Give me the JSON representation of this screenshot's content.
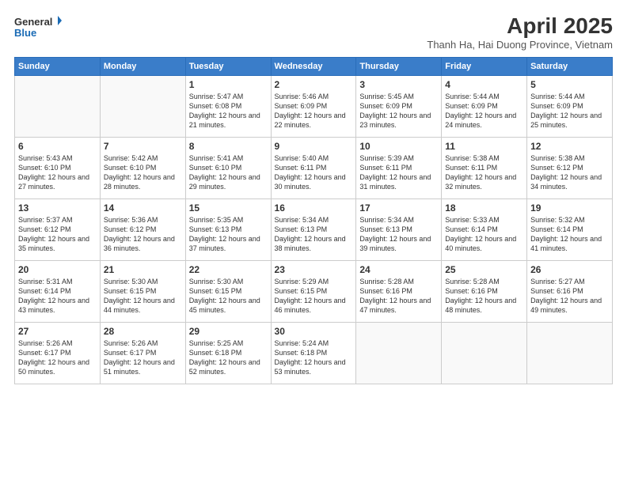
{
  "header": {
    "logo_line1": "General",
    "logo_line2": "Blue",
    "month_title": "April 2025",
    "subtitle": "Thanh Ha, Hai Duong Province, Vietnam"
  },
  "weekdays": [
    "Sunday",
    "Monday",
    "Tuesday",
    "Wednesday",
    "Thursday",
    "Friday",
    "Saturday"
  ],
  "weeks": [
    [
      {
        "day": "",
        "sunrise": "",
        "sunset": "",
        "daylight": ""
      },
      {
        "day": "",
        "sunrise": "",
        "sunset": "",
        "daylight": ""
      },
      {
        "day": "1",
        "sunrise": "Sunrise: 5:47 AM",
        "sunset": "Sunset: 6:08 PM",
        "daylight": "Daylight: 12 hours and 21 minutes."
      },
      {
        "day": "2",
        "sunrise": "Sunrise: 5:46 AM",
        "sunset": "Sunset: 6:09 PM",
        "daylight": "Daylight: 12 hours and 22 minutes."
      },
      {
        "day": "3",
        "sunrise": "Sunrise: 5:45 AM",
        "sunset": "Sunset: 6:09 PM",
        "daylight": "Daylight: 12 hours and 23 minutes."
      },
      {
        "day": "4",
        "sunrise": "Sunrise: 5:44 AM",
        "sunset": "Sunset: 6:09 PM",
        "daylight": "Daylight: 12 hours and 24 minutes."
      },
      {
        "day": "5",
        "sunrise": "Sunrise: 5:44 AM",
        "sunset": "Sunset: 6:09 PM",
        "daylight": "Daylight: 12 hours and 25 minutes."
      }
    ],
    [
      {
        "day": "6",
        "sunrise": "Sunrise: 5:43 AM",
        "sunset": "Sunset: 6:10 PM",
        "daylight": "Daylight: 12 hours and 27 minutes."
      },
      {
        "day": "7",
        "sunrise": "Sunrise: 5:42 AM",
        "sunset": "Sunset: 6:10 PM",
        "daylight": "Daylight: 12 hours and 28 minutes."
      },
      {
        "day": "8",
        "sunrise": "Sunrise: 5:41 AM",
        "sunset": "Sunset: 6:10 PM",
        "daylight": "Daylight: 12 hours and 29 minutes."
      },
      {
        "day": "9",
        "sunrise": "Sunrise: 5:40 AM",
        "sunset": "Sunset: 6:11 PM",
        "daylight": "Daylight: 12 hours and 30 minutes."
      },
      {
        "day": "10",
        "sunrise": "Sunrise: 5:39 AM",
        "sunset": "Sunset: 6:11 PM",
        "daylight": "Daylight: 12 hours and 31 minutes."
      },
      {
        "day": "11",
        "sunrise": "Sunrise: 5:38 AM",
        "sunset": "Sunset: 6:11 PM",
        "daylight": "Daylight: 12 hours and 32 minutes."
      },
      {
        "day": "12",
        "sunrise": "Sunrise: 5:38 AM",
        "sunset": "Sunset: 6:12 PM",
        "daylight": "Daylight: 12 hours and 34 minutes."
      }
    ],
    [
      {
        "day": "13",
        "sunrise": "Sunrise: 5:37 AM",
        "sunset": "Sunset: 6:12 PM",
        "daylight": "Daylight: 12 hours and 35 minutes."
      },
      {
        "day": "14",
        "sunrise": "Sunrise: 5:36 AM",
        "sunset": "Sunset: 6:12 PM",
        "daylight": "Daylight: 12 hours and 36 minutes."
      },
      {
        "day": "15",
        "sunrise": "Sunrise: 5:35 AM",
        "sunset": "Sunset: 6:13 PM",
        "daylight": "Daylight: 12 hours and 37 minutes."
      },
      {
        "day": "16",
        "sunrise": "Sunrise: 5:34 AM",
        "sunset": "Sunset: 6:13 PM",
        "daylight": "Daylight: 12 hours and 38 minutes."
      },
      {
        "day": "17",
        "sunrise": "Sunrise: 5:34 AM",
        "sunset": "Sunset: 6:13 PM",
        "daylight": "Daylight: 12 hours and 39 minutes."
      },
      {
        "day": "18",
        "sunrise": "Sunrise: 5:33 AM",
        "sunset": "Sunset: 6:14 PM",
        "daylight": "Daylight: 12 hours and 40 minutes."
      },
      {
        "day": "19",
        "sunrise": "Sunrise: 5:32 AM",
        "sunset": "Sunset: 6:14 PM",
        "daylight": "Daylight: 12 hours and 41 minutes."
      }
    ],
    [
      {
        "day": "20",
        "sunrise": "Sunrise: 5:31 AM",
        "sunset": "Sunset: 6:14 PM",
        "daylight": "Daylight: 12 hours and 43 minutes."
      },
      {
        "day": "21",
        "sunrise": "Sunrise: 5:30 AM",
        "sunset": "Sunset: 6:15 PM",
        "daylight": "Daylight: 12 hours and 44 minutes."
      },
      {
        "day": "22",
        "sunrise": "Sunrise: 5:30 AM",
        "sunset": "Sunset: 6:15 PM",
        "daylight": "Daylight: 12 hours and 45 minutes."
      },
      {
        "day": "23",
        "sunrise": "Sunrise: 5:29 AM",
        "sunset": "Sunset: 6:15 PM",
        "daylight": "Daylight: 12 hours and 46 minutes."
      },
      {
        "day": "24",
        "sunrise": "Sunrise: 5:28 AM",
        "sunset": "Sunset: 6:16 PM",
        "daylight": "Daylight: 12 hours and 47 minutes."
      },
      {
        "day": "25",
        "sunrise": "Sunrise: 5:28 AM",
        "sunset": "Sunset: 6:16 PM",
        "daylight": "Daylight: 12 hours and 48 minutes."
      },
      {
        "day": "26",
        "sunrise": "Sunrise: 5:27 AM",
        "sunset": "Sunset: 6:16 PM",
        "daylight": "Daylight: 12 hours and 49 minutes."
      }
    ],
    [
      {
        "day": "27",
        "sunrise": "Sunrise: 5:26 AM",
        "sunset": "Sunset: 6:17 PM",
        "daylight": "Daylight: 12 hours and 50 minutes."
      },
      {
        "day": "28",
        "sunrise": "Sunrise: 5:26 AM",
        "sunset": "Sunset: 6:17 PM",
        "daylight": "Daylight: 12 hours and 51 minutes."
      },
      {
        "day": "29",
        "sunrise": "Sunrise: 5:25 AM",
        "sunset": "Sunset: 6:18 PM",
        "daylight": "Daylight: 12 hours and 52 minutes."
      },
      {
        "day": "30",
        "sunrise": "Sunrise: 5:24 AM",
        "sunset": "Sunset: 6:18 PM",
        "daylight": "Daylight: 12 hours and 53 minutes."
      },
      {
        "day": "",
        "sunrise": "",
        "sunset": "",
        "daylight": ""
      },
      {
        "day": "",
        "sunrise": "",
        "sunset": "",
        "daylight": ""
      },
      {
        "day": "",
        "sunrise": "",
        "sunset": "",
        "daylight": ""
      }
    ]
  ]
}
